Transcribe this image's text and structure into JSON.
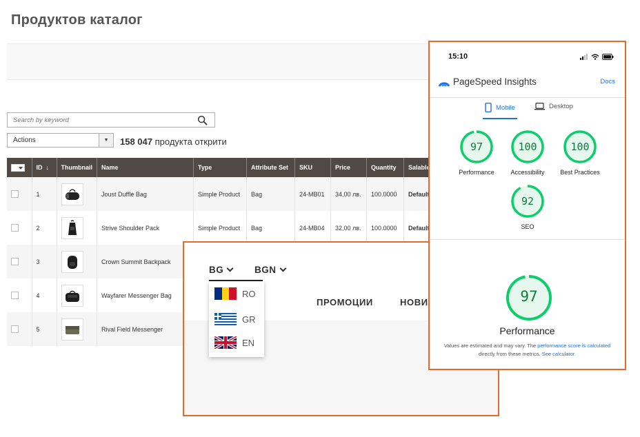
{
  "page_title": "Продуктов каталог",
  "search": {
    "placeholder": "Search by keyword",
    "icon": "search-icon"
  },
  "actions": {
    "label": "Actions"
  },
  "records": {
    "count": "158 047",
    "suffix": "продукта открити"
  },
  "grid": {
    "columns": [
      "ID",
      "Thumbnail",
      "Name",
      "Type",
      "Attribute Set",
      "SKU",
      "Price",
      "Quantity",
      "Salable"
    ],
    "sort_indicator": "↓",
    "rows": [
      {
        "id": "1",
        "name": "Joust Duffle Bag",
        "type": "Simple Product",
        "attr": "Bag",
        "sku": "24-MB01",
        "price": "34,00 лв.",
        "qty": "100.0000",
        "salable": "Default"
      },
      {
        "id": "2",
        "name": "Strive Shoulder Pack",
        "type": "Simple Product",
        "attr": "Bag",
        "sku": "24-MB04",
        "price": "32,00 лв.",
        "qty": "100.0000",
        "salable": "Default"
      },
      {
        "id": "3",
        "name": "Crown Summit Backpack",
        "type": "",
        "attr": "",
        "sku": "",
        "price": "",
        "qty": "",
        "salable": ""
      },
      {
        "id": "4",
        "name": "Wayfarer Messenger Bag",
        "type": "",
        "attr": "",
        "sku": "",
        "price": "",
        "qty": "",
        "salable": ""
      },
      {
        "id": "5",
        "name": "Rival Field Messenger",
        "type": "",
        "attr": "",
        "sku": "",
        "price": "",
        "qty": "",
        "salable": ""
      }
    ]
  },
  "language_switcher": {
    "language": "BG",
    "currency": "BGN",
    "options": [
      {
        "code": "RO",
        "flag": "romania-flag-icon"
      },
      {
        "code": "GR",
        "flag": "greece-flag-icon"
      },
      {
        "code": "EN",
        "flag": "uk-flag-icon"
      }
    ],
    "nav": [
      "ПРОМОЦИИ",
      "НОВИ"
    ]
  },
  "pagespeed": {
    "time": "15:10",
    "app_name": "PageSpeed Insights",
    "docs": "Docs",
    "tabs": {
      "mobile": "Mobile",
      "desktop": "Desktop"
    },
    "scores": [
      {
        "label": "Performance",
        "value": "97",
        "fraction": 0.97
      },
      {
        "label": "Accessibility",
        "value": "100",
        "fraction": 1.0
      },
      {
        "label": "Best Practices",
        "value": "100",
        "fraction": 1.0
      },
      {
        "label": "SEO",
        "value": "92",
        "fraction": 0.92
      }
    ],
    "main_score": {
      "label": "Performance",
      "value": "97",
      "fraction": 0.97
    },
    "note": {
      "text1": "Values are estimated and may vary. The ",
      "link1": "performance score is calculated",
      "text2": "directly from these metrics. ",
      "link2": "See calculator."
    },
    "colors": {
      "good": "#0cce6b",
      "good_bg": "#e6f8ee",
      "accent": "#1a73e8",
      "frame": "#e8692a"
    }
  }
}
